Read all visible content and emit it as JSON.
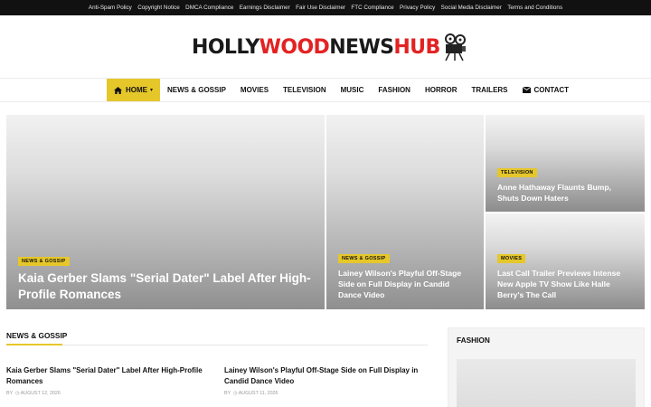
{
  "topbar": {
    "links": [
      "Anti-Spam Policy",
      "Copyright Notice",
      "DMCA Compliance",
      "Earnings Disclaimer",
      "Fair Use Disclaimer",
      "FTC Compliance",
      "Privacy Policy",
      "Social Media Disclaimer",
      "Terms and Conditions"
    ]
  },
  "logo": {
    "part1": "H",
    "part2": "LLY",
    "part3": "WOOD",
    "part4": "NEWS",
    "part5": "HUB",
    "icon": "film-camera-icon"
  },
  "nav": {
    "items": [
      "HOME",
      "NEWS & GOSSIP",
      "MOVIES",
      "TELEVISION",
      "MUSIC",
      "FASHION",
      "HORROR",
      "TRAILERS",
      "CONTACT"
    ],
    "home_icon": "home-icon",
    "contact_icon": "envelope-icon",
    "accent": "#e6c72a"
  },
  "hero": {
    "main": {
      "category": "NEWS & GOSSIP",
      "title": "Kaia Gerber Slams \"Serial Dater\" Label After High-Profile Romances"
    },
    "middle": {
      "category": "NEWS & GOSSIP",
      "title": "Lainey Wilson's Playful Off-Stage Side on Full Display in Candid Dance Video"
    },
    "top_right": {
      "category": "TELEVISION",
      "title": "Anne Hathaway Flaunts Bump, Shuts Down Haters"
    },
    "bottom_right": {
      "category": "MOVIES",
      "title": "Last Call Trailer Previews Intense New Apple TV Show Like Halle Berry's The Call"
    }
  },
  "section": {
    "title": "NEWS & GOSSIP",
    "posts": [
      {
        "title": "Kaia Gerber Slams \"Serial Dater\" Label After High-Profile Romances",
        "by": "BY",
        "date": "AUGUST 12, 2026"
      },
      {
        "title": "Lainey Wilson's Playful Off-Stage Side on Full Display in Candid Dance Video",
        "by": "BY",
        "date": "AUGUST 11, 2026"
      }
    ]
  },
  "sidebar": {
    "title": "FASHION"
  }
}
